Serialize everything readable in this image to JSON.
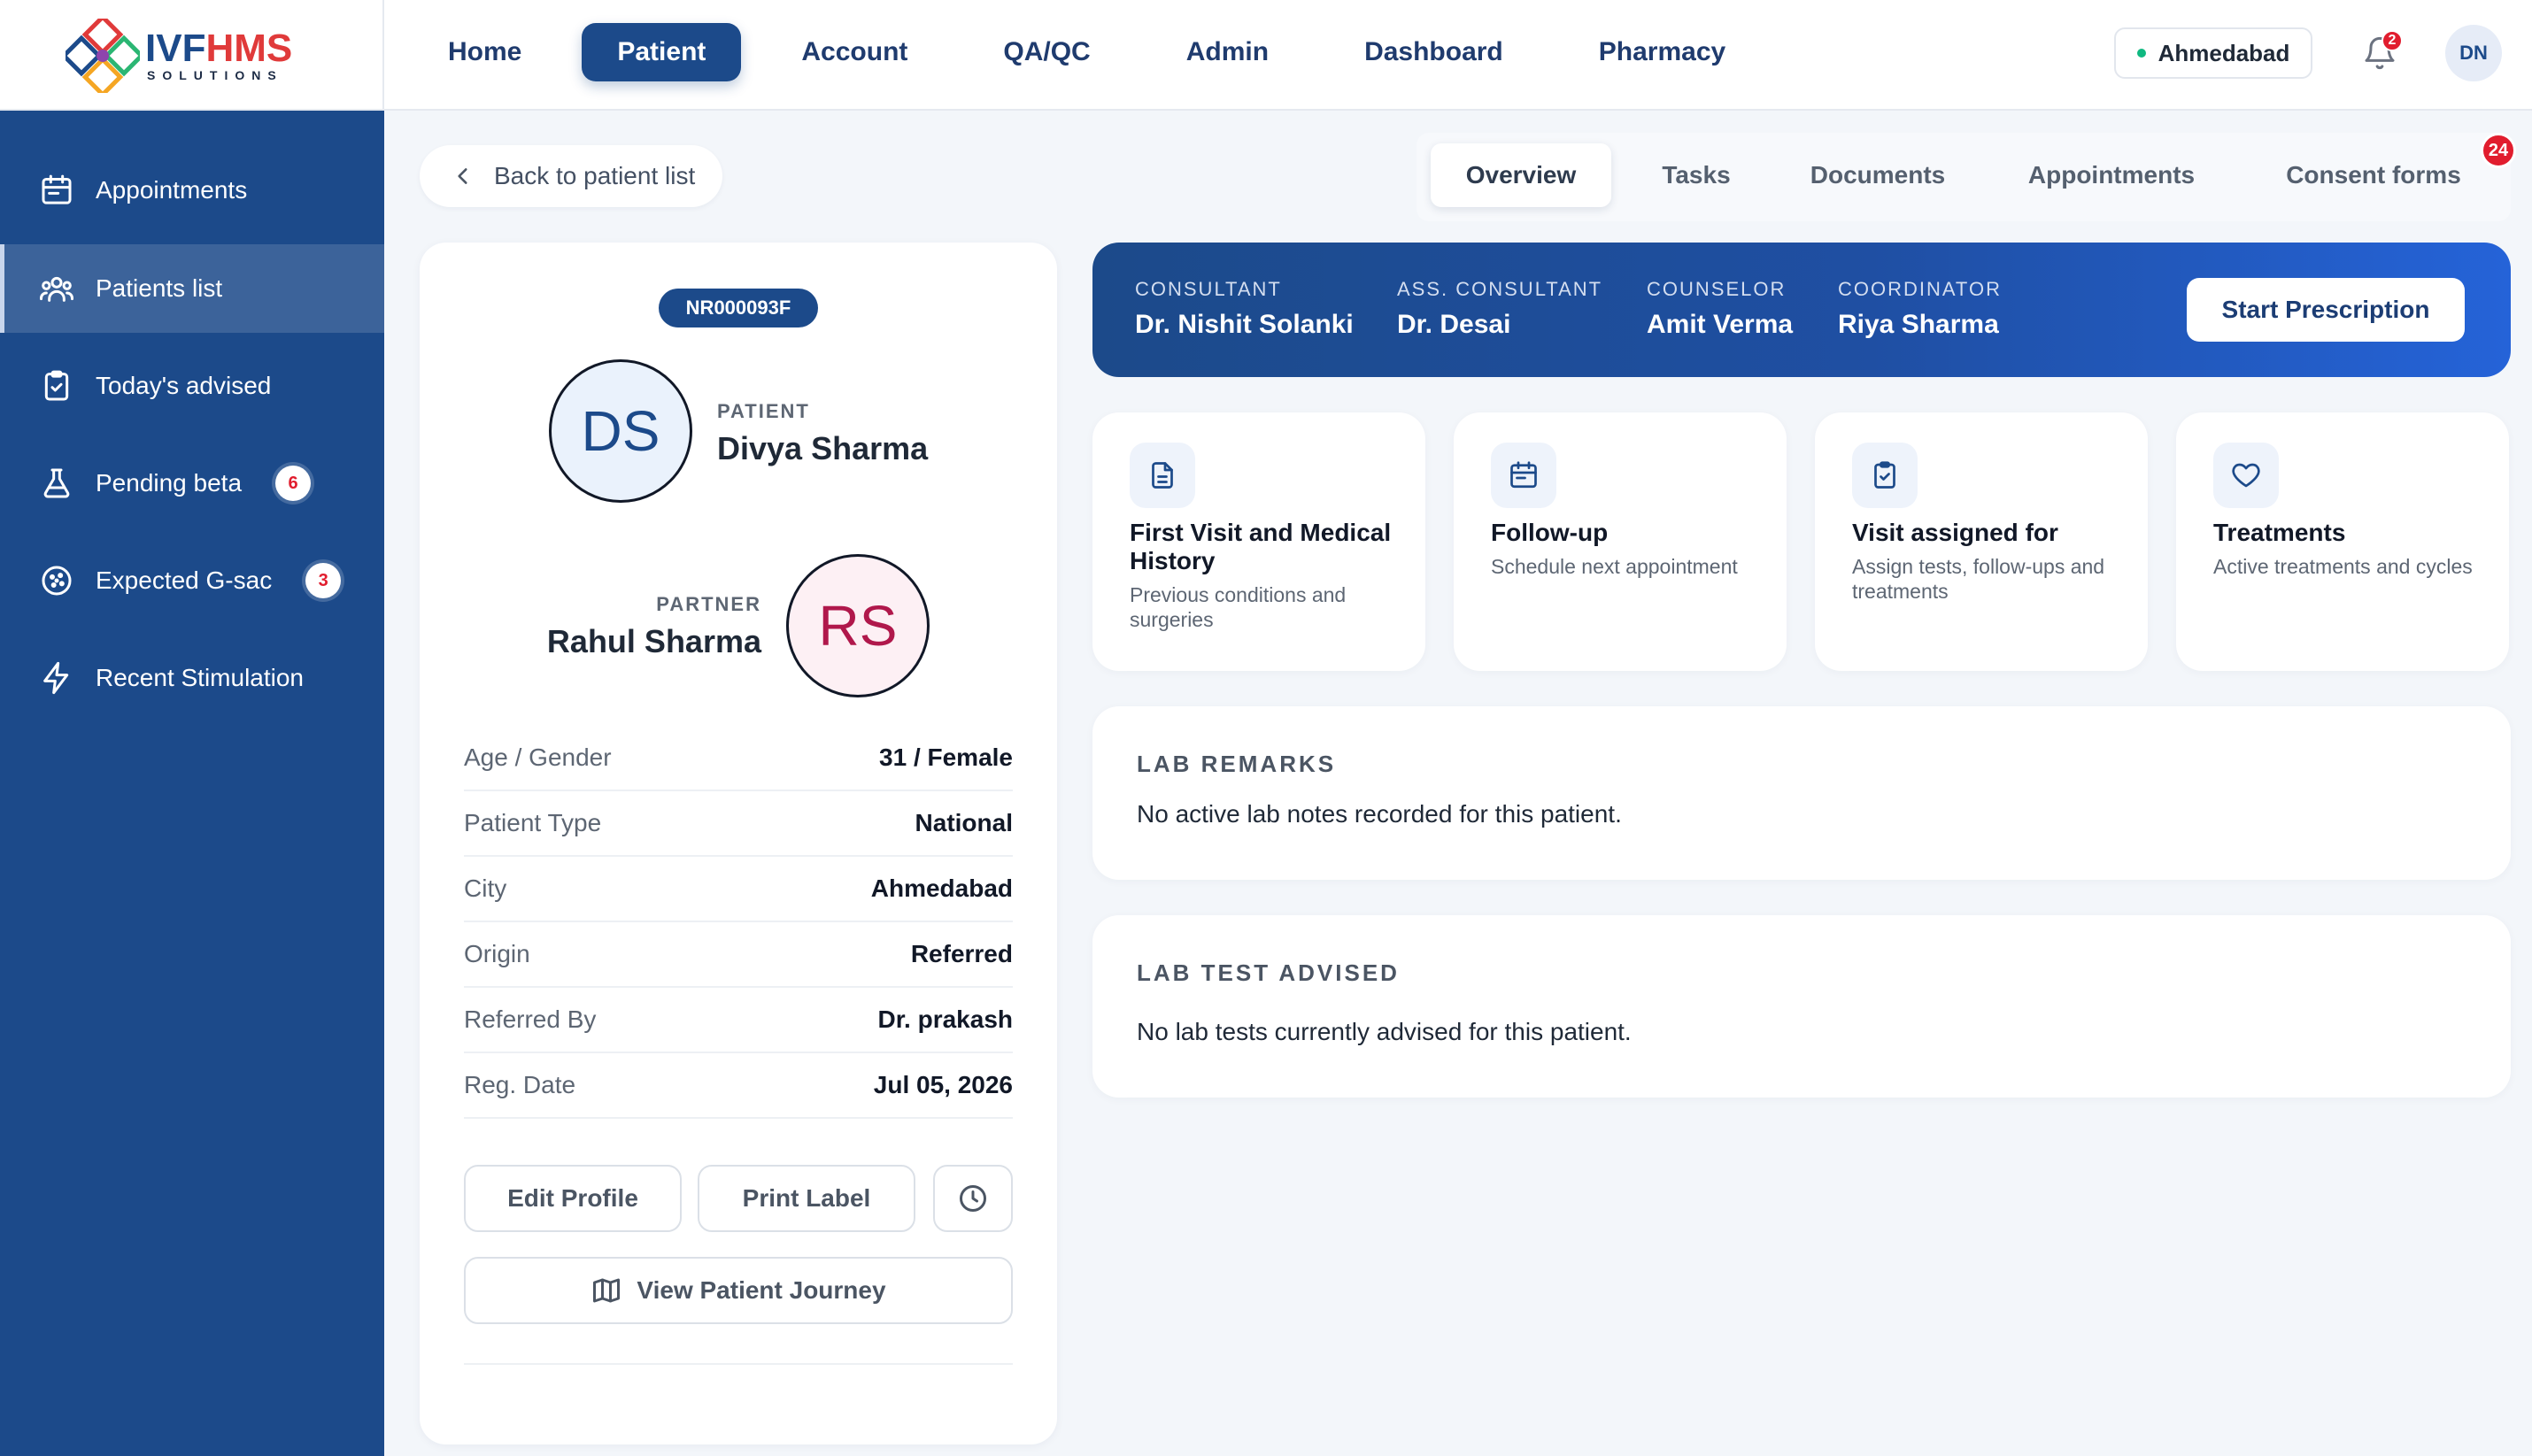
{
  "brand": {
    "name_primary": "IVF",
    "name_accent": "HMS",
    "tagline": "SOLUTIONS"
  },
  "topnav": [
    {
      "label": "Home",
      "active": false
    },
    {
      "label": "Patient",
      "active": true
    },
    {
      "label": "Account",
      "active": false
    },
    {
      "label": "QA/QC",
      "active": false
    },
    {
      "label": "Admin",
      "active": false
    },
    {
      "label": "Dashboard",
      "active": false
    },
    {
      "label": "Pharmacy",
      "active": false
    }
  ],
  "header": {
    "location": "Ahmedabad",
    "notifications": "2",
    "user_initials": "DN"
  },
  "sidebar": {
    "items": [
      {
        "label": "Appointments",
        "icon": "calendar-icon"
      },
      {
        "label": "Patients list",
        "icon": "users-icon",
        "active": true
      },
      {
        "label": "Today's advised",
        "icon": "clipboard-check-icon"
      },
      {
        "label": "Pending beta",
        "icon": "flask-icon",
        "badge": "6"
      },
      {
        "label": "Expected G-sac",
        "icon": "dots-circle-icon",
        "badge": "3"
      },
      {
        "label": "Recent Stimulation",
        "icon": "bolt-icon"
      }
    ]
  },
  "back": {
    "label": "Back to patient list"
  },
  "tabs": {
    "items": [
      "Overview",
      "Tasks",
      "Documents",
      "Appointments",
      "Consent forms"
    ],
    "active": "Overview",
    "consent_badge": "24"
  },
  "patient": {
    "id": "NR000093F",
    "patient_role": "PATIENT",
    "patient_initials": "DS",
    "patient_name": "Divya Sharma",
    "partner_role": "PARTNER",
    "partner_initials": "RS",
    "partner_name": "Rahul Sharma",
    "details": [
      {
        "label": "Age / Gender",
        "value": "31 / Female"
      },
      {
        "label": "Patient Type",
        "value": "National"
      },
      {
        "label": "City",
        "value": "Ahmedabad"
      },
      {
        "label": "Origin",
        "value": "Referred"
      },
      {
        "label": "Referred By",
        "value": "Dr. prakash"
      },
      {
        "label": "Reg. Date",
        "value": "Jul 05, 2026"
      }
    ],
    "actions": {
      "edit": "Edit Profile",
      "print": "Print Label",
      "journey": "View Patient Journey"
    }
  },
  "care_team": {
    "members": [
      {
        "role": "CONSULTANT",
        "name": "Dr. Nishit Solanki"
      },
      {
        "role": "ASS. CONSULTANT",
        "name": "Dr. Desai"
      },
      {
        "role": "COUNSELOR",
        "name": "Amit Verma"
      },
      {
        "role": "COORDINATOR",
        "name": "Riya Sharma"
      }
    ],
    "action": "Start Prescription"
  },
  "tiles": [
    {
      "icon": "document-icon",
      "title": "First Visit and Medical History",
      "desc": "Previous conditions and surgeries"
    },
    {
      "icon": "calendar-icon",
      "title": "Follow-up",
      "desc": "Schedule next appointment"
    },
    {
      "icon": "clipboard-check-icon",
      "title": "Visit assigned for",
      "desc": "Assign tests, follow-ups and treatments"
    },
    {
      "icon": "heart-icon",
      "title": "Treatments",
      "desc": "Active treatments and cycles"
    }
  ],
  "lab_remarks": {
    "title": "LAB REMARKS",
    "text": "No active lab notes recorded for this patient."
  },
  "lab_tests": {
    "title": "LAB TEST ADVISED",
    "text": "No lab tests currently advised for this patient."
  },
  "colors": {
    "primary": "#1c4a8a",
    "accent_red": "#e11d2e",
    "online": "#10b981",
    "page_bg": "#f3f6fa"
  }
}
